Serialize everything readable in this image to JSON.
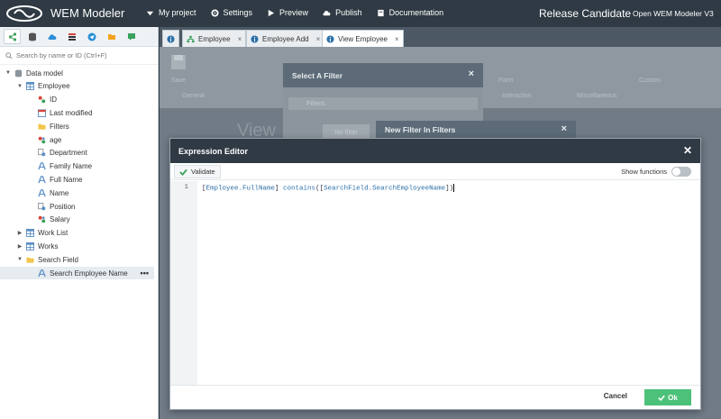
{
  "topbar": {
    "brand": "WEM Modeler",
    "menu": [
      {
        "label": "My project",
        "icon": "caret-down-icon"
      },
      {
        "label": "Settings",
        "icon": "gear-icon"
      },
      {
        "label": "Preview",
        "icon": "play-icon"
      },
      {
        "label": "Publish",
        "icon": "cloud-upload-icon"
      },
      {
        "label": "Documentation",
        "icon": "book-icon"
      }
    ],
    "release": "Release Candidate",
    "open_v3": "Open WEM Modeler V3"
  },
  "leftpanel": {
    "search_placeholder": "Search by name or ID (Ctrl+F)",
    "tree": [
      {
        "label": "Data model",
        "level": 0,
        "toggle": "▼",
        "icon": "database-icon"
      },
      {
        "label": "Employee",
        "level": 1,
        "toggle": "▼",
        "icon": "table-icon"
      },
      {
        "label": "ID",
        "level": 2,
        "toggle": "",
        "icon": "key-field-icon"
      },
      {
        "label": "Last modified",
        "level": 2,
        "toggle": "",
        "icon": "date-field-icon"
      },
      {
        "label": "Filters",
        "level": 2,
        "toggle": "",
        "icon": "folder-icon"
      },
      {
        "label": "age",
        "level": 2,
        "toggle": "",
        "icon": "number-field-icon"
      },
      {
        "label": "Department",
        "level": 2,
        "toggle": "",
        "icon": "reference-field-icon"
      },
      {
        "label": "Family Name",
        "level": 2,
        "toggle": "",
        "icon": "text-field-icon"
      },
      {
        "label": "Full Name",
        "level": 2,
        "toggle": "",
        "icon": "text-field-icon"
      },
      {
        "label": "Name",
        "level": 2,
        "toggle": "",
        "icon": "text-field-icon"
      },
      {
        "label": "Position",
        "level": 2,
        "toggle": "",
        "icon": "reference-field-icon"
      },
      {
        "label": "Salary",
        "level": 2,
        "toggle": "",
        "icon": "number-field-icon"
      },
      {
        "label": "Work List",
        "level": 1,
        "toggle": "▶",
        "icon": "table-icon"
      },
      {
        "label": "Works",
        "level": 1,
        "toggle": "▶",
        "icon": "table-icon"
      },
      {
        "label": "Search Field",
        "level": 1,
        "toggle": "▼",
        "icon": "folder-icon"
      },
      {
        "label": "Search Employee Name",
        "level": 2,
        "toggle": "",
        "icon": "text-field-icon",
        "selected": true
      }
    ]
  },
  "tabs": [
    {
      "label": "",
      "icon": "info-icon"
    },
    {
      "label": "Employee",
      "icon": "flowchart-icon"
    },
    {
      "label": "Employee Add",
      "icon": "info-icon"
    },
    {
      "label": "View Employee",
      "icon": "info-icon"
    }
  ],
  "background": {
    "save": "Save",
    "general": "General",
    "form": "Form",
    "interaction": "Interaction",
    "miscellaneous": "Miscellaneous",
    "custom": "Custom",
    "view_text": "View"
  },
  "filter_dialog": {
    "title": "Select A Filter",
    "filters": "Filters",
    "no_filter": "No filter"
  },
  "new_filter_dialog": {
    "title": "New Filter In Filters"
  },
  "expression_editor": {
    "title": "Expression Editor",
    "validate": "Validate",
    "show_functions": "Show functions",
    "show_functions_on": false,
    "line_number": "1",
    "code": {
      "open": "[",
      "field1": "Employee.FullName",
      "close1": "] ",
      "keyword": "contains",
      "paren_open": "([",
      "field2": "SearchField.SearchEmployeeName",
      "close2": "])"
    },
    "cancel": "Cancel",
    "ok": "Ok"
  },
  "colors": {
    "topbar": "#2f3a44",
    "ok_button": "#4cc17a",
    "token": "#2a6fa8"
  }
}
